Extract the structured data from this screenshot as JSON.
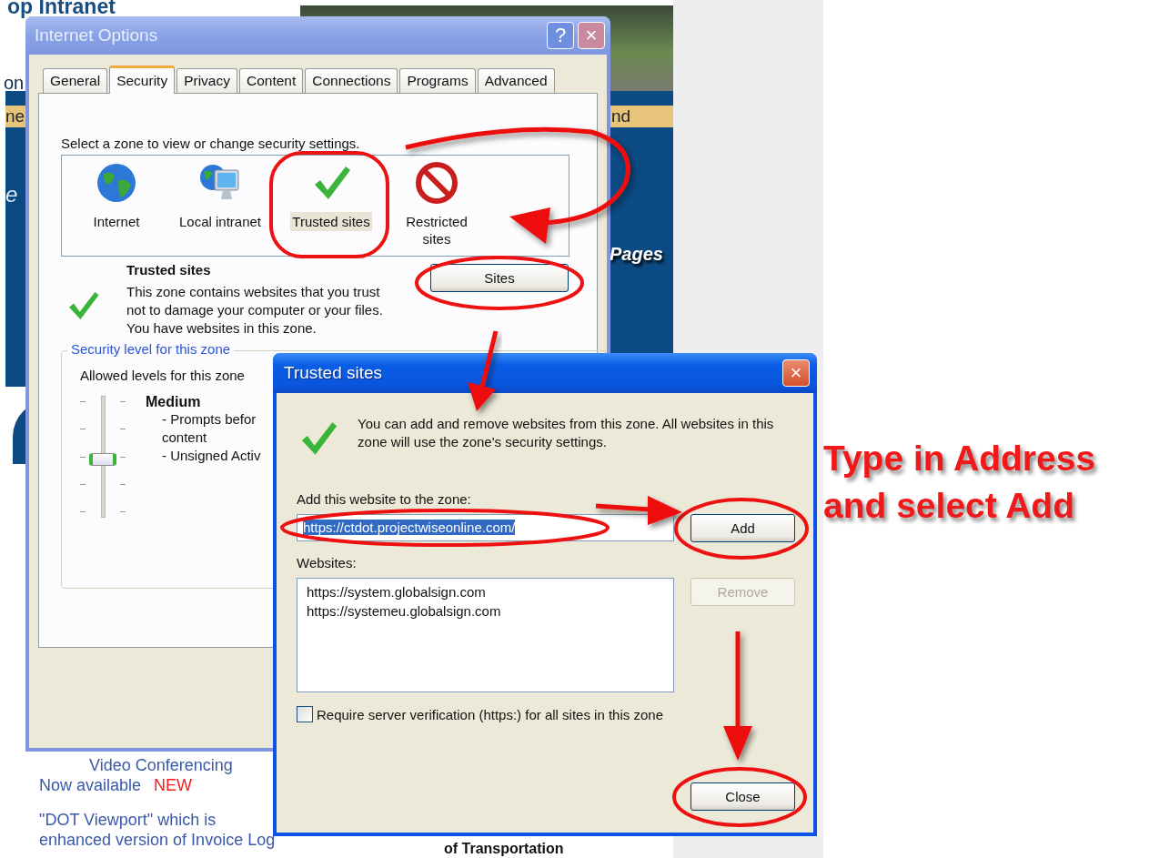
{
  "background_page": {
    "header": "op Intranet",
    "side_fragments": [
      "on",
      "e"
    ],
    "banner_left": "ne",
    "banner_right": "nd",
    "pages_link": "Pages",
    "news": [
      {
        "text": "Video Conferencing"
      },
      {
        "text": "Now available",
        "badge": "NEW"
      }
    ],
    "paragraph": [
      "\"DOT Viewport\" which is",
      "enhanced version of Invoice Log"
    ],
    "footer_heading": "of Transportation"
  },
  "internet_options": {
    "title": "Internet Options",
    "help": "?",
    "close": "×",
    "tabs": [
      {
        "label": "General",
        "selected": false
      },
      {
        "label": "Security",
        "selected": true
      },
      {
        "label": "Privacy",
        "selected": false
      },
      {
        "label": "Content",
        "selected": false
      },
      {
        "label": "Connections",
        "selected": false
      },
      {
        "label": "Programs",
        "selected": false
      },
      {
        "label": "Advanced",
        "selected": false
      }
    ],
    "zone_prompt": "Select a zone to view or change security settings.",
    "zones": [
      {
        "label": "Internet",
        "kind": "globe",
        "selected": false
      },
      {
        "label": "Local intranet",
        "kind": "intranet",
        "selected": false
      },
      {
        "label": "Trusted sites",
        "kind": "trusted",
        "selected": true
      },
      {
        "label": "Restricted sites",
        "kind": "restricted",
        "selected": false
      }
    ],
    "zone_name": "Trusted sites",
    "zone_description": "This zone contains websites that you trust not to damage your computer or your files.",
    "zone_note": "You have websites in this zone.",
    "sites_button": "Sites",
    "security_level": {
      "legend": "Security level for this zone",
      "allowed": "Allowed levels for this zone",
      "level": 0.5,
      "name": "Medium",
      "details": [
        "- Prompts befor",
        "content",
        "- Unsigned Activ"
      ]
    }
  },
  "trusted_sites": {
    "title": "Trusted sites",
    "close": "×",
    "info": "You can add and remove websites from this zone. All websites in this zone will use the zone's security settings.",
    "add_label": "Add this website to the zone:",
    "address": {
      "value": "https://ctdot.projectwiseonline.com/",
      "text_selected": true
    },
    "add_button": {
      "label": "Add",
      "disabled": false
    },
    "websites_label": "Websites:",
    "websites": [
      "https://system.globalsign.com",
      "https://systemeu.globalsign.com"
    ],
    "remove_button": {
      "label": "Remove",
      "disabled": true
    },
    "require_https": {
      "label": "Require server verification (https:) for all sites in this zone",
      "checked": false
    },
    "close_button": "Close"
  },
  "annotation": {
    "lines": [
      "Type in Address",
      "and select Add"
    ]
  }
}
